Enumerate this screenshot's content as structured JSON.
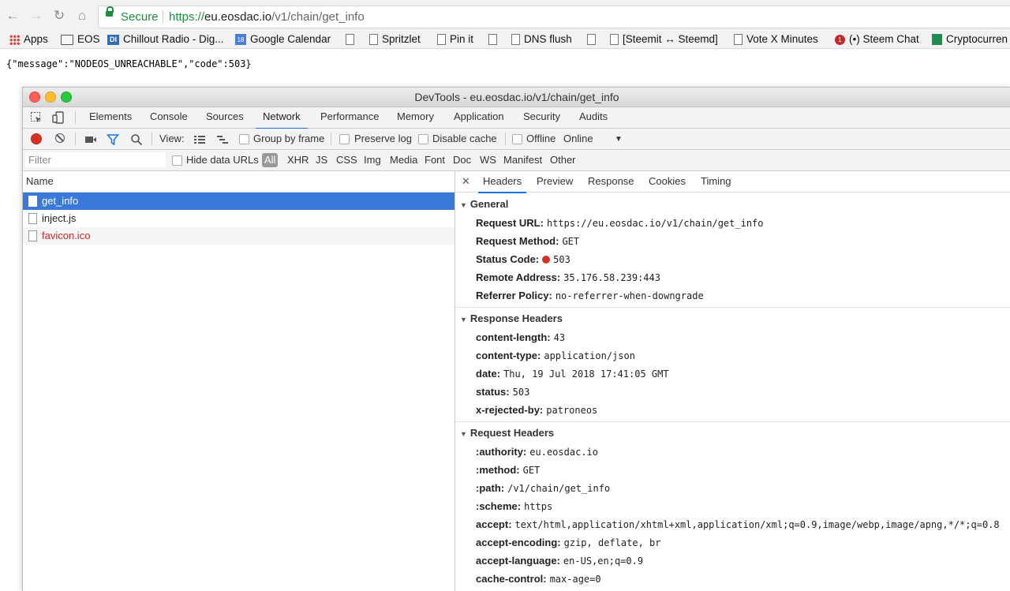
{
  "browser": {
    "secure_label": "Secure",
    "url_scheme": "https://",
    "url_host": "eu.eosdac.io",
    "url_path": "/v1/chain/get_info",
    "bookmarks": [
      {
        "label": "Apps",
        "icon": "apps-grid-icon"
      },
      {
        "label": "EOS",
        "icon": "folder-icon"
      },
      {
        "label": "Chillout Radio - Dig...",
        "icon": "di-radio-icon"
      },
      {
        "label": "Google Calendar",
        "icon": "calendar-icon"
      },
      {
        "label": "Spritzlet",
        "icon": "page-icon"
      },
      {
        "label": "Pin it",
        "icon": "page-icon"
      },
      {
        "label": "DNS flush",
        "icon": "page-icon"
      },
      {
        "label": "[Steemit ↔ Steemd]",
        "icon": "page-icon"
      },
      {
        "label": "Vote X Minutes",
        "icon": "page-icon"
      },
      {
        "label": "(•) Steem Chat",
        "icon": "notification-badge-icon"
      },
      {
        "label": "Cryptocurren",
        "icon": "sheets-icon"
      }
    ]
  },
  "page_body": "{\"message\":\"NODEOS_UNREACHABLE\",\"code\":503}",
  "devtools": {
    "title": "DevTools - eu.eosdac.io/v1/chain/get_info",
    "tabs": [
      "Elements",
      "Console",
      "Sources",
      "Network",
      "Performance",
      "Memory",
      "Application",
      "Security",
      "Audits"
    ],
    "active_tab": "Network",
    "toolbar": {
      "view_label": "View:",
      "group_by_frame": "Group by frame",
      "preserve_log": "Preserve log",
      "disable_cache": "Disable cache",
      "offline": "Offline",
      "throttle": "Online"
    },
    "filter": {
      "placeholder": "Filter",
      "hide_data_urls": "Hide data URLs",
      "types": [
        "All",
        "XHR",
        "JS",
        "CSS",
        "Img",
        "Media",
        "Font",
        "Doc",
        "WS",
        "Manifest",
        "Other"
      ]
    },
    "requests": {
      "column": "Name",
      "items": [
        "get_info",
        "inject.js",
        "favicon.ico"
      ]
    },
    "detail": {
      "tabs": [
        "Headers",
        "Preview",
        "Response",
        "Cookies",
        "Timing"
      ],
      "general": {
        "title": "General",
        "rows": [
          {
            "k": "Request URL:",
            "v": "https://eu.eosdac.io/v1/chain/get_info"
          },
          {
            "k": "Request Method:",
            "v": "GET"
          },
          {
            "k": "Status Code:",
            "v": "503"
          },
          {
            "k": "Remote Address:",
            "v": "35.176.58.239:443"
          },
          {
            "k": "Referrer Policy:",
            "v": "no-referrer-when-downgrade"
          }
        ]
      },
      "response": {
        "title": "Response Headers",
        "rows": [
          {
            "k": "content-length:",
            "v": "43"
          },
          {
            "k": "content-type:",
            "v": "application/json"
          },
          {
            "k": "date:",
            "v": "Thu, 19 Jul 2018 17:41:05 GMT"
          },
          {
            "k": "status:",
            "v": "503"
          },
          {
            "k": "x-rejected-by:",
            "v": "patroneos"
          }
        ]
      },
      "request": {
        "title": "Request Headers",
        "rows": [
          {
            "k": ":authority:",
            "v": "eu.eosdac.io"
          },
          {
            "k": ":method:",
            "v": "GET"
          },
          {
            "k": ":path:",
            "v": "/v1/chain/get_info"
          },
          {
            "k": ":scheme:",
            "v": "https"
          },
          {
            "k": "accept:",
            "v": "text/html,application/xhtml+xml,application/xml;q=0.9,image/webp,image/apng,*/*;q=0.8"
          },
          {
            "k": "accept-encoding:",
            "v": "gzip, deflate, br"
          },
          {
            "k": "accept-language:",
            "v": "en-US,en;q=0.9"
          },
          {
            "k": "cache-control:",
            "v": "max-age=0"
          }
        ]
      }
    }
  }
}
